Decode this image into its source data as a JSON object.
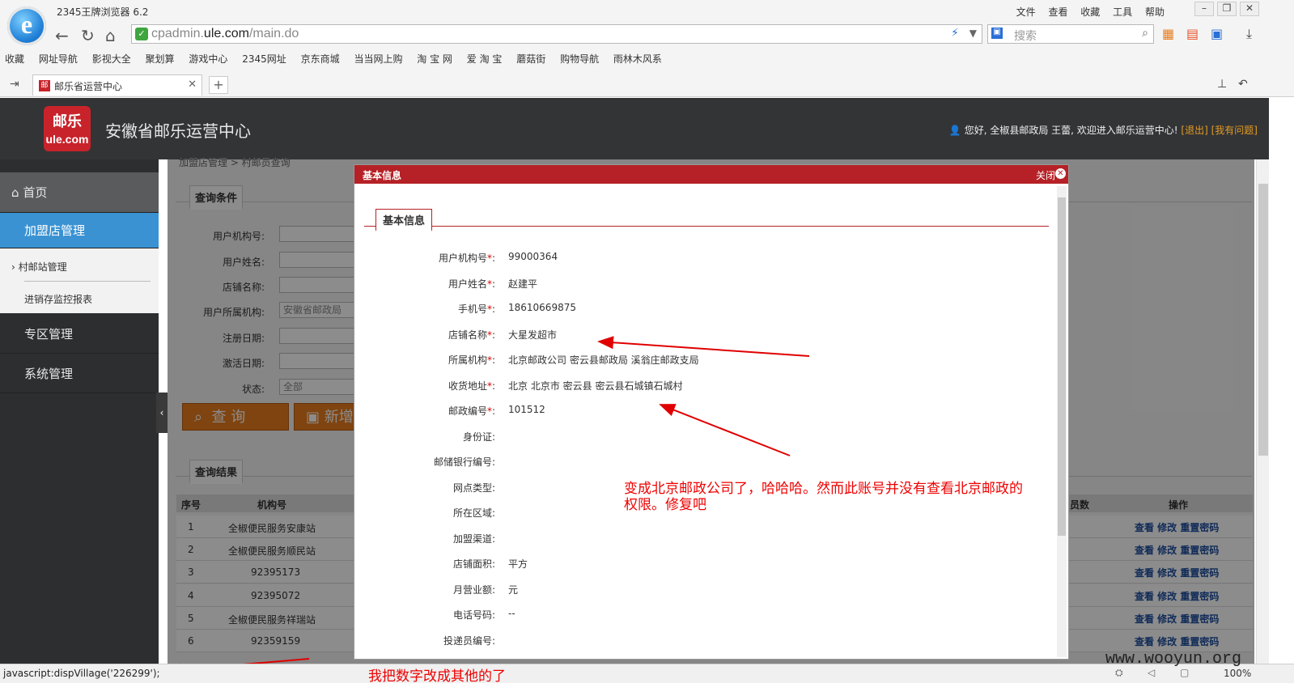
{
  "browser": {
    "title": "2345王牌浏览器 6.2",
    "menu": [
      "文件",
      "查看",
      "收藏",
      "工具",
      "帮助"
    ],
    "url_host": "cpadmin.",
    "url_domain": "ule.com",
    "url_path": "/main.do",
    "search_placeholder": "搜索",
    "bookmarks": [
      "收藏",
      "网址导航",
      "影视大全",
      "聚划算",
      "游戏中心",
      "2345网址",
      "京东商城",
      "当当网上购",
      "淘 宝 网",
      "爱 淘 宝",
      "蘑菇街",
      "购物导航",
      "雨林木风系"
    ],
    "tab_title": "邮乐省运营中心",
    "zoom": "100%",
    "status_text": "javascript:dispVillage('226299');"
  },
  "header": {
    "logo_line1": "邮乐",
    "logo_line2": "ule.com",
    "title": "安徽省邮乐运营中心",
    "welcome": "您好, 全椒县邮政局  王蕾, 欢迎进入邮乐运营中心!",
    "logout": "[退出]",
    "help": "[我有问题]"
  },
  "sidebar": {
    "home": "首页",
    "join": "加盟店管理",
    "sub_items": [
      "村邮站管理",
      "进销存监控报表"
    ],
    "zone": "专区管理",
    "system": "系统管理"
  },
  "main": {
    "breadcrumb": "加盟店管理 > 村邮员查询",
    "query_tab": "查询条件",
    "form_labels": [
      "用户机构号:",
      "用户姓名:",
      "店铺名称:",
      "用户所属机构:",
      "注册日期:",
      "激活日期:",
      "状态:"
    ],
    "org_value": "安徽省邮政局",
    "status_value": "全部",
    "query_button": "查 询",
    "add_button": "新增",
    "result_tab": "查询结果",
    "table_headers": [
      "序号",
      "机构号",
      "员数",
      "操作"
    ],
    "rows": [
      {
        "no": "1",
        "org": "全椒便民服务安康站"
      },
      {
        "no": "2",
        "org": "全椒便民服务顺民站"
      },
      {
        "no": "3",
        "org": "92395173"
      },
      {
        "no": "4",
        "org": "92395072"
      },
      {
        "no": "5",
        "org": "全椒便民服务祥瑞站"
      },
      {
        "no": "6",
        "org": "92359159"
      }
    ],
    "ops": "查看 修改 重置密码"
  },
  "modal": {
    "title": "基本信息",
    "close": "关闭",
    "tab": "基本信息",
    "fields": [
      {
        "label": "用户机构号",
        "required": true,
        "value": "99000364"
      },
      {
        "label": "用户姓名",
        "required": true,
        "value": "赵建平"
      },
      {
        "label": "手机号",
        "required": true,
        "value": "18610669875"
      },
      {
        "label": "店铺名称",
        "required": true,
        "value": "大星发超市"
      },
      {
        "label": "所属机构",
        "required": true,
        "value": "北京邮政公司 密云县邮政局 溪翁庄邮政支局"
      },
      {
        "label": "收货地址",
        "required": true,
        "value": "北京 北京市 密云县 密云县石城镇石城村"
      },
      {
        "label": "邮政编号",
        "required": true,
        "value": "101512"
      },
      {
        "label": "身份证",
        "required": false,
        "value": ""
      },
      {
        "label": "邮储银行编号",
        "required": false,
        "value": ""
      },
      {
        "label": "网点类型",
        "required": false,
        "value": ""
      },
      {
        "label": "所在区域",
        "required": false,
        "value": ""
      },
      {
        "label": "加盟渠道",
        "required": false,
        "value": ""
      },
      {
        "label": "店铺面积",
        "required": false,
        "value": "平方"
      },
      {
        "label": "月营业额",
        "required": false,
        "value": "元"
      },
      {
        "label": "电话号码",
        "required": false,
        "value": "--"
      },
      {
        "label": "投递员编号",
        "required": false,
        "value": ""
      }
    ]
  },
  "annotations": {
    "main": "变成北京邮政公司了，哈哈哈。然而此账号并没有查看北京邮政的",
    "main2": "权限。修复吧",
    "bottom": "我把数字改成其他的了",
    "color": "#e00000"
  },
  "watermark": "www.wooyun.org"
}
